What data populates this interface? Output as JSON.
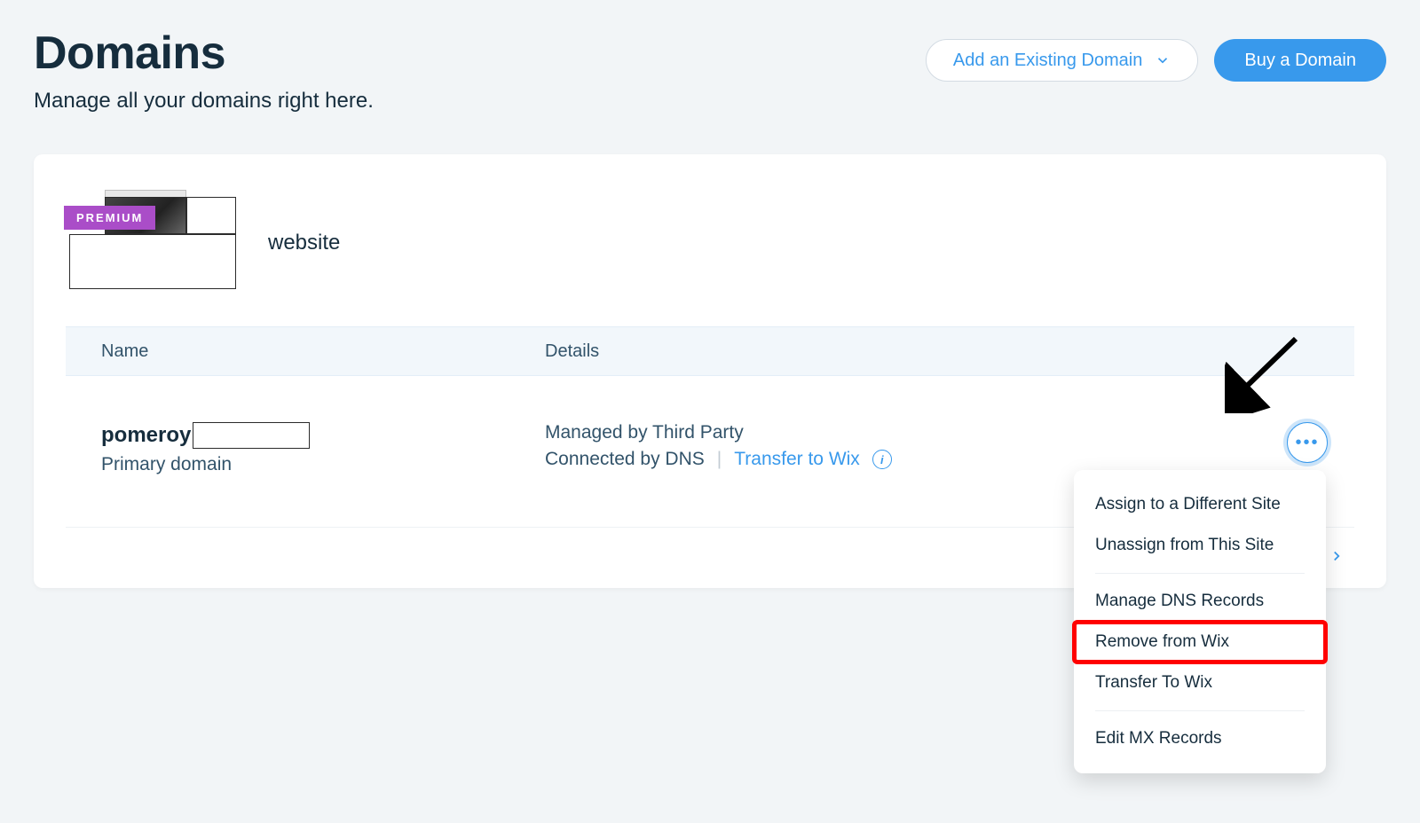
{
  "header": {
    "title": "Domains",
    "subtitle": "Manage all your domains right here.",
    "add_existing_label": "Add an Existing Domain",
    "buy_domain_label": "Buy a Domain"
  },
  "site": {
    "badge": "PREMIUM",
    "name": "website"
  },
  "table": {
    "columns": {
      "name": "Name",
      "details": "Details"
    },
    "rows": [
      {
        "domain_name": "pomeroy",
        "domain_sub": "Primary domain",
        "details_line1": "Managed by Third Party",
        "details_connected": "Connected by DNS",
        "transfer_link": "Transfer to Wix"
      }
    ]
  },
  "more_menu": {
    "items": [
      {
        "label": "Assign to a Different Site"
      },
      {
        "label": "Unassign from This Site"
      },
      {
        "label": "Manage DNS Records"
      },
      {
        "label": "Remove from Wix",
        "highlight": true
      },
      {
        "label": "Transfer To Wix"
      },
      {
        "label": "Edit MX Records"
      }
    ],
    "separator_after": [
      1,
      4
    ]
  },
  "icons": {
    "chevron_down": "chevron-down-icon",
    "info": "info-icon",
    "more": "more-icon",
    "chevron_right": "chevron-right-icon",
    "arrow": "arrow-annotation"
  }
}
